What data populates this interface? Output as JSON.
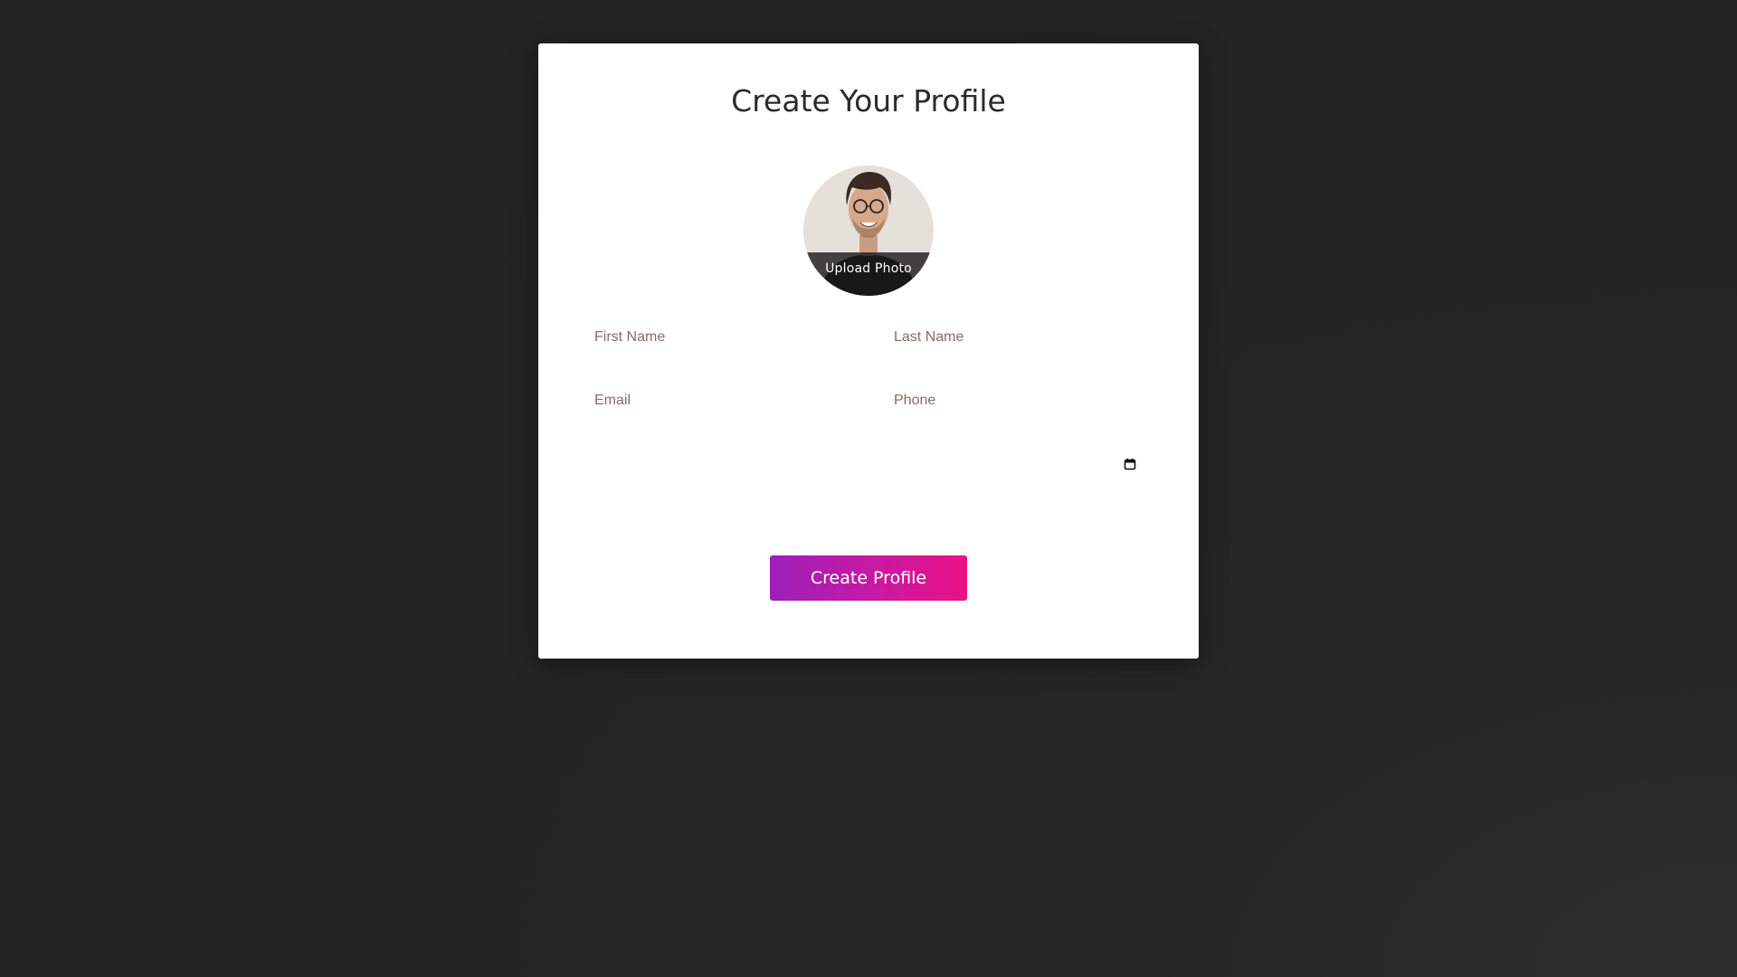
{
  "form": {
    "title": "Create Your Profile",
    "avatar_label": "Upload Photo",
    "fields": {
      "first_name_placeholder": "First Name",
      "last_name_placeholder": "Last Name",
      "email_placeholder": "Email",
      "phone_placeholder": "Phone"
    },
    "submit_label": "Create Profile"
  },
  "colors": {
    "background": "#242424",
    "card": "#ffffff",
    "placeholder": "#8a6a66",
    "button_gradient_start": "#9c1fb8",
    "button_gradient_end": "#ea1183"
  },
  "icons": {
    "date": "calendar-icon"
  }
}
